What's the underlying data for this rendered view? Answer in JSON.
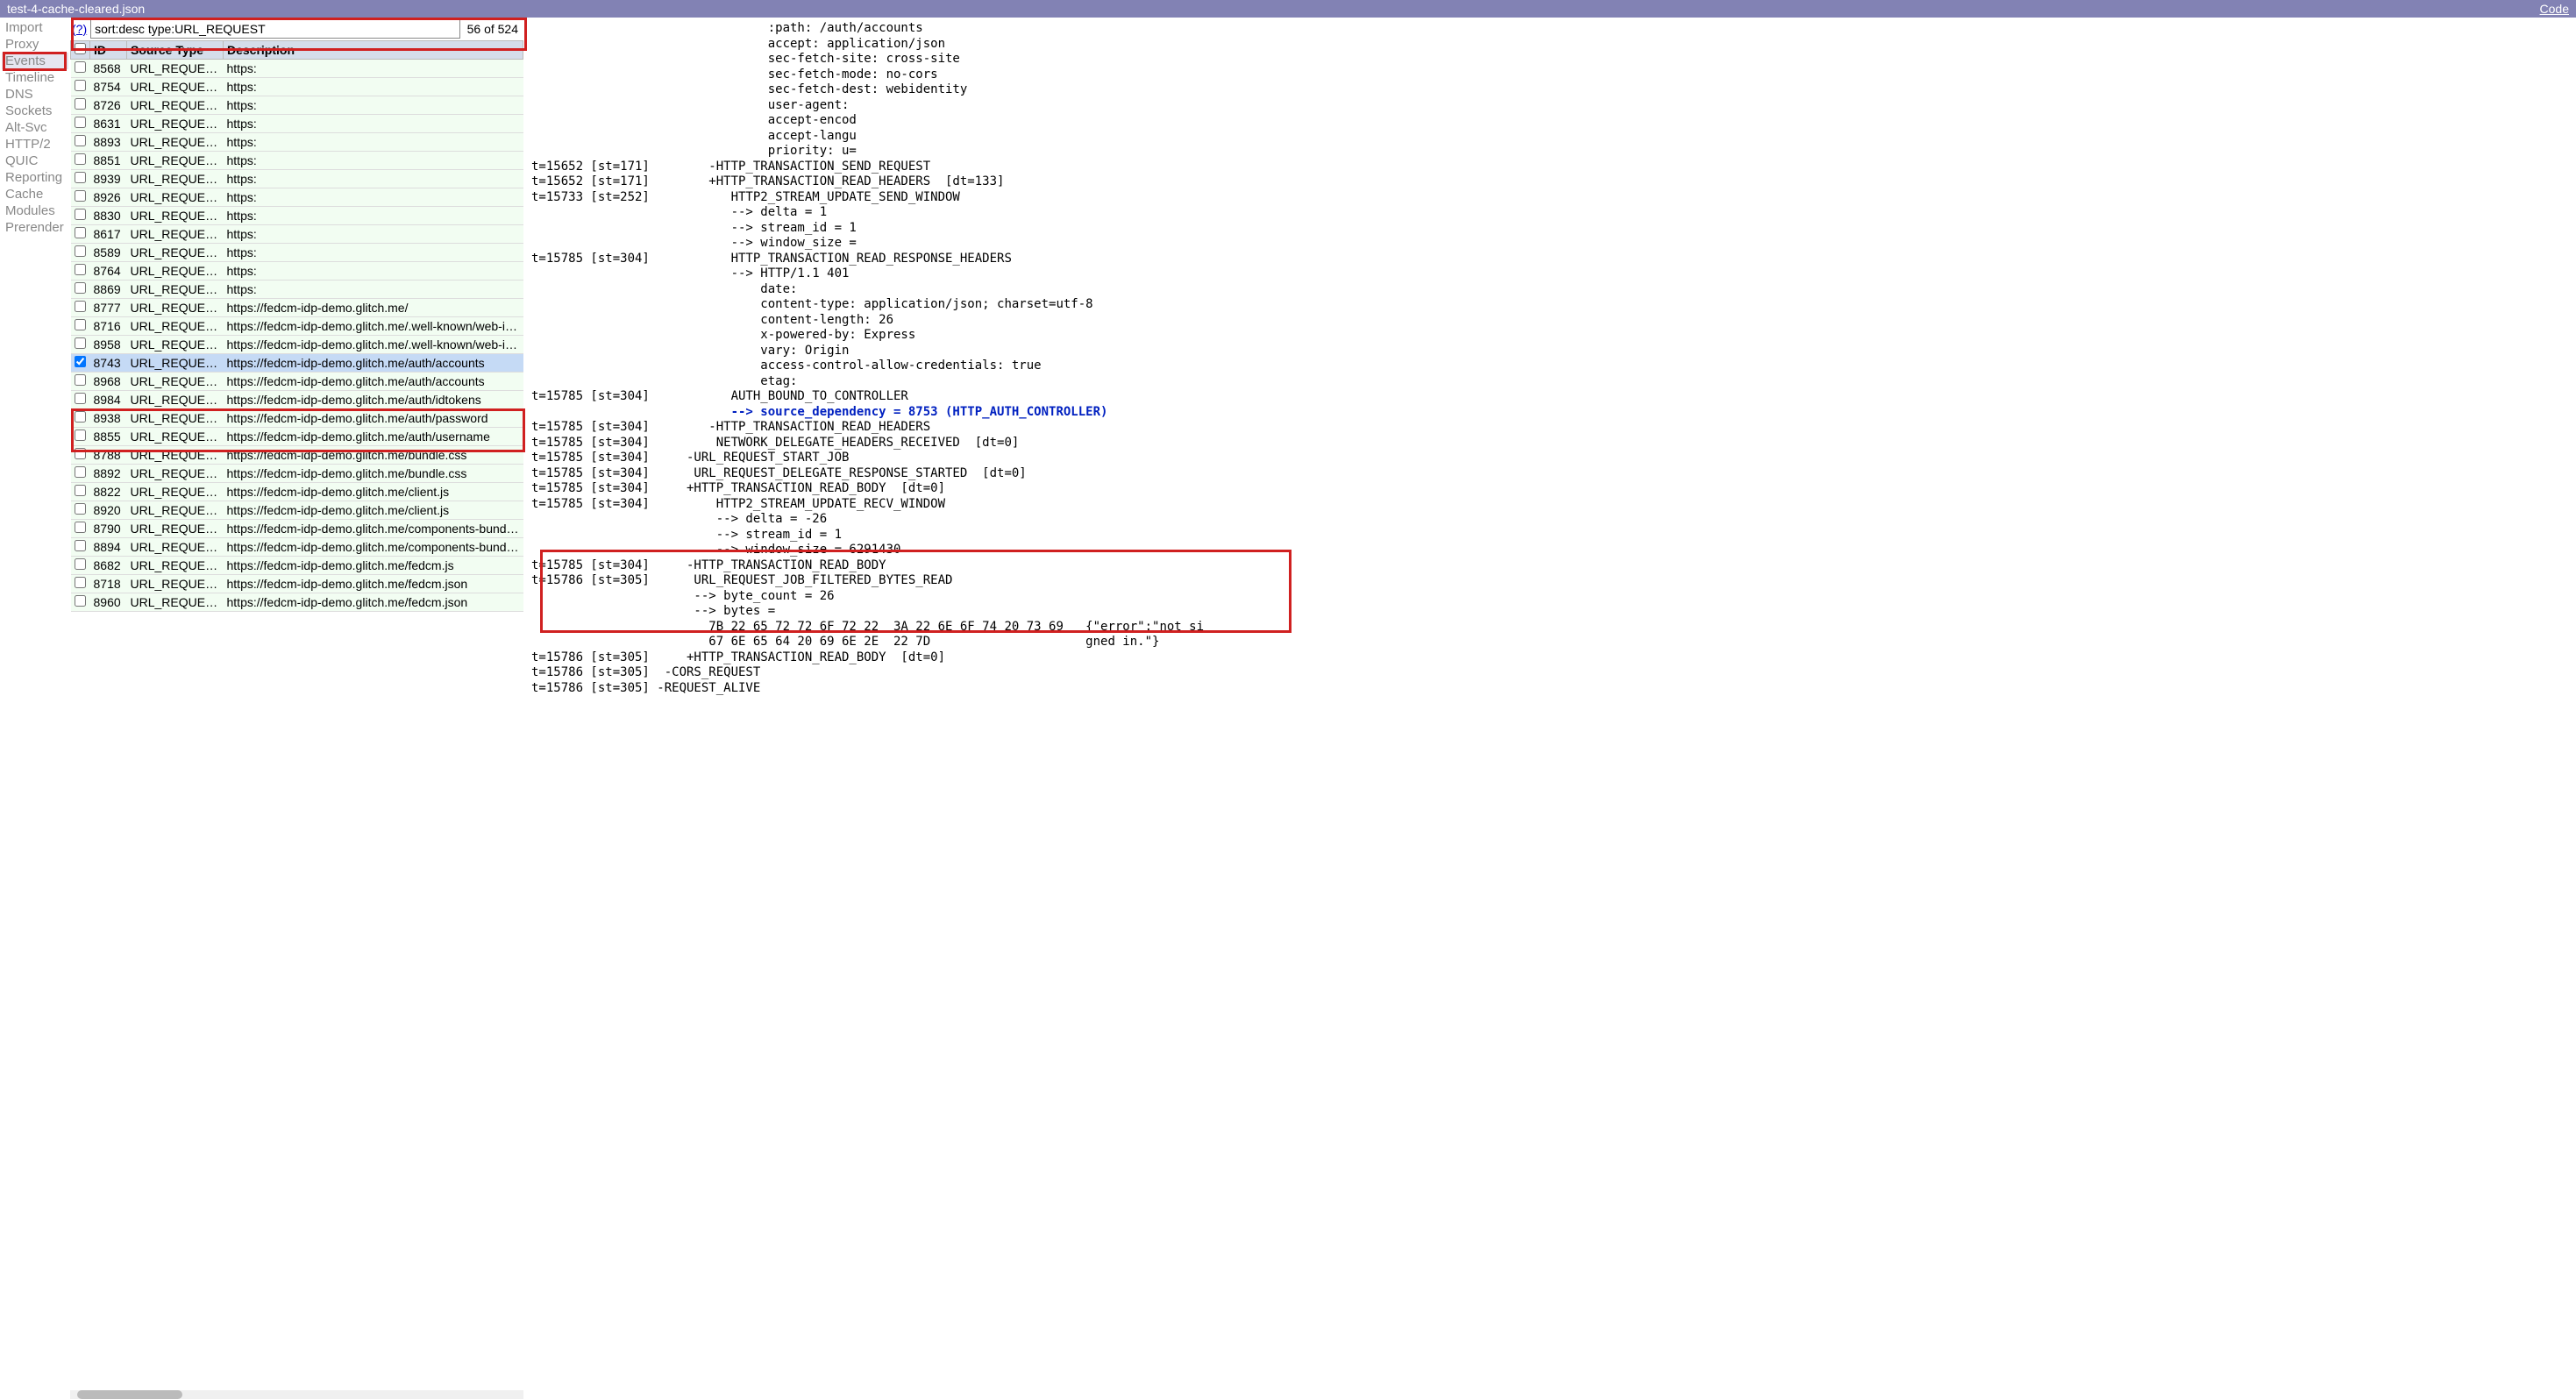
{
  "header": {
    "filename": "test-4-cache-cleared.json",
    "code_link": "Code"
  },
  "sidebar": {
    "items": [
      {
        "label": "Import",
        "active": false
      },
      {
        "label": "Proxy",
        "active": false
      },
      {
        "label": "Events",
        "active": true
      },
      {
        "label": "Timeline",
        "active": false
      },
      {
        "label": "DNS",
        "active": false
      },
      {
        "label": "Sockets",
        "active": false
      },
      {
        "label": "Alt-Svc",
        "active": false
      },
      {
        "label": "HTTP/2",
        "active": false
      },
      {
        "label": "QUIC",
        "active": false
      },
      {
        "label": "Reporting",
        "active": false
      },
      {
        "label": "Cache",
        "active": false
      },
      {
        "label": "Modules",
        "active": false
      },
      {
        "label": "Prerender",
        "active": false
      }
    ]
  },
  "filter": {
    "help": "(?)",
    "value": "sort:desc type:URL_REQUEST",
    "count": "56 of 524"
  },
  "tableHeaders": [
    "",
    "ID",
    "Source Type",
    "Description"
  ],
  "events": [
    {
      "checked": false,
      "id": "8568",
      "type": "URL_REQUEST",
      "desc": "https:",
      "selected": false
    },
    {
      "checked": false,
      "id": "8754",
      "type": "URL_REQUEST",
      "desc": "https:",
      "selected": false
    },
    {
      "checked": false,
      "id": "8726",
      "type": "URL_REQUEST",
      "desc": "https:",
      "selected": false
    },
    {
      "checked": false,
      "id": "8631",
      "type": "URL_REQUEST",
      "desc": "https:",
      "selected": false
    },
    {
      "checked": false,
      "id": "8893",
      "type": "URL_REQUEST",
      "desc": "https:",
      "selected": false
    },
    {
      "checked": false,
      "id": "8851",
      "type": "URL_REQUEST",
      "desc": "https:",
      "selected": false
    },
    {
      "checked": false,
      "id": "8939",
      "type": "URL_REQUEST",
      "desc": "https:",
      "selected": false
    },
    {
      "checked": false,
      "id": "8926",
      "type": "URL_REQUEST",
      "desc": "https:",
      "selected": false
    },
    {
      "checked": false,
      "id": "8830",
      "type": "URL_REQUEST",
      "desc": "https:",
      "selected": false
    },
    {
      "checked": false,
      "id": "8617",
      "type": "URL_REQUEST",
      "desc": "https:",
      "selected": false
    },
    {
      "checked": false,
      "id": "8589",
      "type": "URL_REQUEST",
      "desc": "https:",
      "selected": false
    },
    {
      "checked": false,
      "id": "8764",
      "type": "URL_REQUEST",
      "desc": "https:",
      "selected": false
    },
    {
      "checked": false,
      "id": "8869",
      "type": "URL_REQUEST",
      "desc": "https:",
      "selected": false
    },
    {
      "checked": false,
      "id": "8777",
      "type": "URL_REQUEST",
      "desc": "https://fedcm-idp-demo.glitch.me/",
      "selected": false
    },
    {
      "checked": false,
      "id": "8716",
      "type": "URL_REQUEST",
      "desc": "https://fedcm-idp-demo.glitch.me/.well-known/web-iden",
      "selected": false
    },
    {
      "checked": false,
      "id": "8958",
      "type": "URL_REQUEST",
      "desc": "https://fedcm-idp-demo.glitch.me/.well-known/web-iden",
      "selected": false
    },
    {
      "checked": true,
      "id": "8743",
      "type": "URL_REQUEST",
      "desc": "https://fedcm-idp-demo.glitch.me/auth/accounts",
      "selected": true
    },
    {
      "checked": false,
      "id": "8968",
      "type": "URL_REQUEST",
      "desc": "https://fedcm-idp-demo.glitch.me/auth/accounts",
      "selected": false
    },
    {
      "checked": false,
      "id": "8984",
      "type": "URL_REQUEST",
      "desc": "https://fedcm-idp-demo.glitch.me/auth/idtokens",
      "selected": false
    },
    {
      "checked": false,
      "id": "8938",
      "type": "URL_REQUEST",
      "desc": "https://fedcm-idp-demo.glitch.me/auth/password",
      "selected": false
    },
    {
      "checked": false,
      "id": "8855",
      "type": "URL_REQUEST",
      "desc": "https://fedcm-idp-demo.glitch.me/auth/username",
      "selected": false
    },
    {
      "checked": false,
      "id": "8788",
      "type": "URL_REQUEST",
      "desc": "https://fedcm-idp-demo.glitch.me/bundle.css",
      "selected": false
    },
    {
      "checked": false,
      "id": "8892",
      "type": "URL_REQUEST",
      "desc": "https://fedcm-idp-demo.glitch.me/bundle.css",
      "selected": false
    },
    {
      "checked": false,
      "id": "8822",
      "type": "URL_REQUEST",
      "desc": "https://fedcm-idp-demo.glitch.me/client.js",
      "selected": false
    },
    {
      "checked": false,
      "id": "8920",
      "type": "URL_REQUEST",
      "desc": "https://fedcm-idp-demo.glitch.me/client.js",
      "selected": false
    },
    {
      "checked": false,
      "id": "8790",
      "type": "URL_REQUEST",
      "desc": "https://fedcm-idp-demo.glitch.me/components-bundle.j",
      "selected": false
    },
    {
      "checked": false,
      "id": "8894",
      "type": "URL_REQUEST",
      "desc": "https://fedcm-idp-demo.glitch.me/components-bundle.j",
      "selected": false
    },
    {
      "checked": false,
      "id": "8682",
      "type": "URL_REQUEST",
      "desc": "https://fedcm-idp-demo.glitch.me/fedcm.js",
      "selected": false
    },
    {
      "checked": false,
      "id": "8718",
      "type": "URL_REQUEST",
      "desc": "https://fedcm-idp-demo.glitch.me/fedcm.json",
      "selected": false
    },
    {
      "checked": false,
      "id": "8960",
      "type": "URL_REQUEST",
      "desc": "https://fedcm-idp-demo.glitch.me/fedcm.json",
      "selected": false
    }
  ],
  "log": {
    "lines": [
      {
        "text": "                                :path: /auth/accounts"
      },
      {
        "text": "                                accept: application/json"
      },
      {
        "text": "                                sec-fetch-site: cross-site"
      },
      {
        "text": "                                sec-fetch-mode: no-cors"
      },
      {
        "text": "                                sec-fetch-dest: webidentity"
      },
      {
        "text": "                                user-agent:"
      },
      {
        "text": "                                accept-encod"
      },
      {
        "text": "                                accept-langu"
      },
      {
        "text": "                                priority: u="
      },
      {
        "text": "t=15652 [st=171]        -HTTP_TRANSACTION_SEND_REQUEST"
      },
      {
        "text": "t=15652 [st=171]        +HTTP_TRANSACTION_READ_HEADERS  [dt=133]"
      },
      {
        "text": "t=15733 [st=252]           HTTP2_STREAM_UPDATE_SEND_WINDOW"
      },
      {
        "text": "                           --> delta = 1"
      },
      {
        "text": "                           --> stream_id = 1"
      },
      {
        "text": "                           --> window_size ="
      },
      {
        "text": "t=15785 [st=304]           HTTP_TRANSACTION_READ_RESPONSE_HEADERS"
      },
      {
        "text": "                           --> HTTP/1.1 401"
      },
      {
        "text": "                               date:"
      },
      {
        "text": "                               content-type: application/json; charset=utf-8"
      },
      {
        "text": "                               content-length: 26"
      },
      {
        "text": "                               x-powered-by: Express"
      },
      {
        "text": "                               vary: Origin"
      },
      {
        "text": "                               access-control-allow-credentials: true"
      },
      {
        "text": "                               etag:"
      },
      {
        "text": "t=15785 [st=304]           AUTH_BOUND_TO_CONTROLLER"
      },
      {
        "blue": true,
        "text": "                           --> source_dependency = 8753 (HTTP_AUTH_CONTROLLER)"
      },
      {
        "text": "t=15785 [st=304]        -HTTP_TRANSACTION_READ_HEADERS"
      },
      {
        "text": "t=15785 [st=304]         NETWORK_DELEGATE_HEADERS_RECEIVED  [dt=0]"
      },
      {
        "text": "t=15785 [st=304]     -URL_REQUEST_START_JOB"
      },
      {
        "text": "t=15785 [st=304]      URL_REQUEST_DELEGATE_RESPONSE_STARTED  [dt=0]"
      },
      {
        "text": "t=15785 [st=304]     +HTTP_TRANSACTION_READ_BODY  [dt=0]"
      },
      {
        "text": "t=15785 [st=304]         HTTP2_STREAM_UPDATE_RECV_WINDOW"
      },
      {
        "text": "                         --> delta = -26"
      },
      {
        "text": "                         --> stream_id = 1"
      },
      {
        "text": "                         --> window_size = 6291430"
      },
      {
        "text": "t=15785 [st=304]     -HTTP_TRANSACTION_READ_BODY"
      },
      {
        "text": "t=15786 [st=305]      URL_REQUEST_JOB_FILTERED_BYTES_READ"
      },
      {
        "text": "                      --> byte_count = 26"
      },
      {
        "text": "                      --> bytes ="
      },
      {
        "text": "                        7B 22 65 72 72 6F 72 22  3A 22 6E 6F 74 20 73 69   {\"error\":\"not si"
      },
      {
        "text": "                        67 6E 65 64 20 69 6E 2E  22 7D                     gned in.\"}"
      },
      {
        "text": "t=15786 [st=305]     +HTTP_TRANSACTION_READ_BODY  [dt=0]"
      },
      {
        "text": "t=15786 [st=305]  -CORS_REQUEST"
      },
      {
        "text": "t=15786 [st=305] -REQUEST_ALIVE"
      }
    ]
  }
}
